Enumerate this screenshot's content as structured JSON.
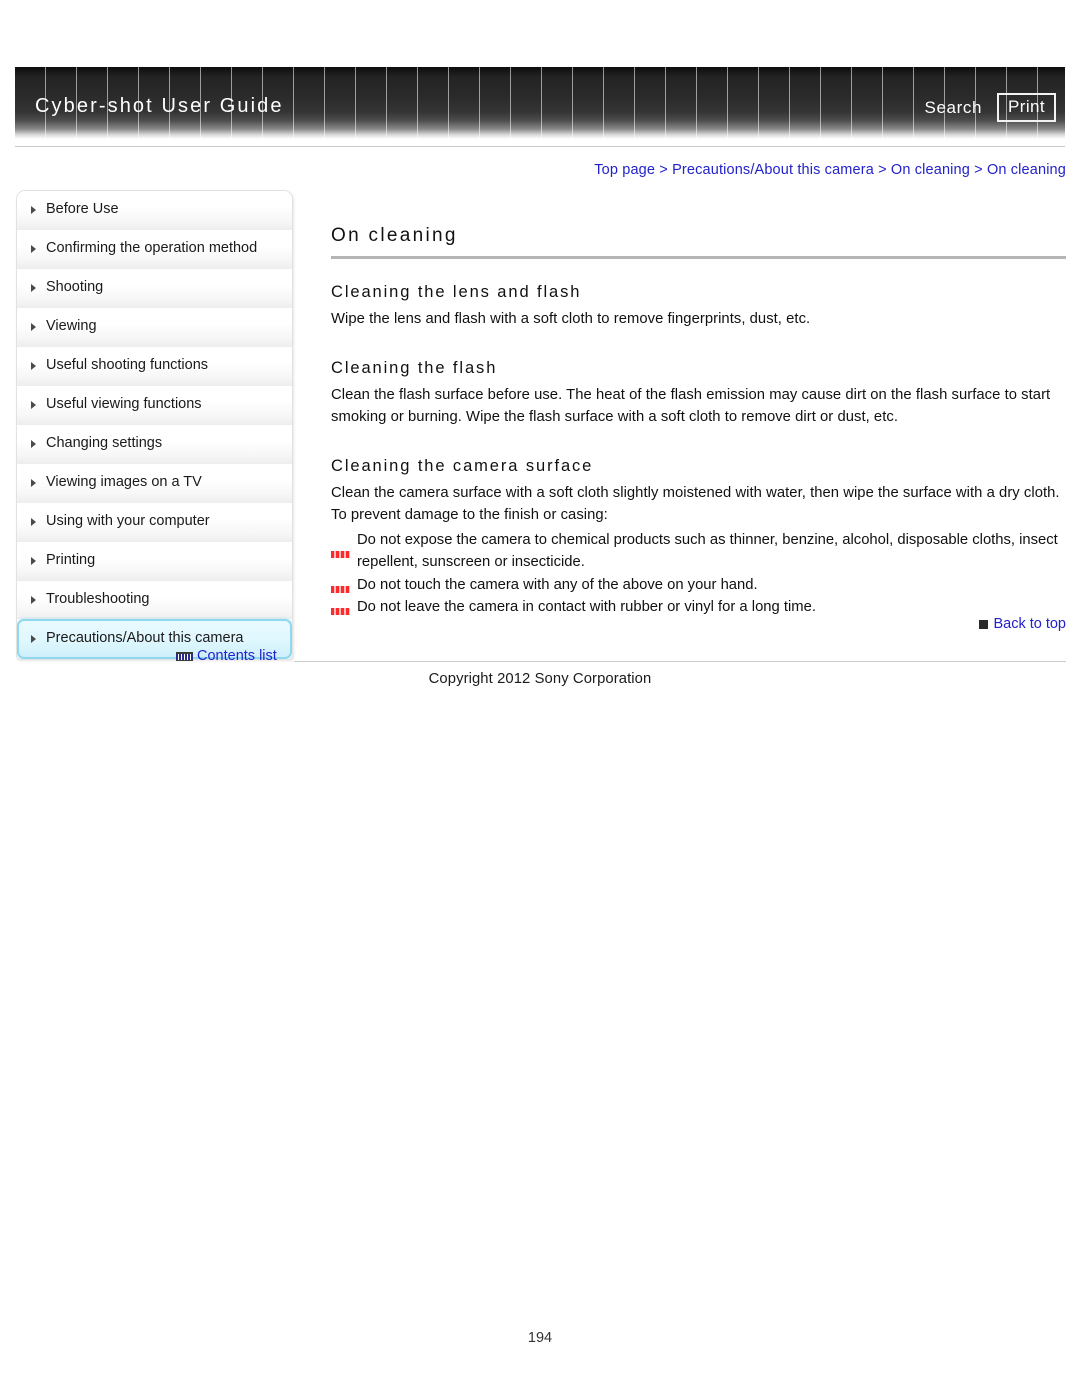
{
  "header": {
    "title": "Cyber-shot User Guide",
    "search_label": "Search",
    "print_label": "Print"
  },
  "breadcrumb": {
    "items": [
      "Top page",
      "Precautions/About this camera",
      "On cleaning",
      "On cleaning"
    ],
    "separator": ">"
  },
  "sidebar": {
    "items": [
      {
        "label": "Before Use",
        "active": false
      },
      {
        "label": "Confirming the operation method",
        "active": false
      },
      {
        "label": "Shooting",
        "active": false
      },
      {
        "label": "Viewing",
        "active": false
      },
      {
        "label": "Useful shooting functions",
        "active": false
      },
      {
        "label": "Useful viewing functions",
        "active": false
      },
      {
        "label": "Changing settings",
        "active": false
      },
      {
        "label": "Viewing images on a TV",
        "active": false
      },
      {
        "label": "Using with your computer",
        "active": false
      },
      {
        "label": "Printing",
        "active": false
      },
      {
        "label": "Troubleshooting",
        "active": false
      },
      {
        "label": "Precautions/About this camera",
        "active": true
      }
    ],
    "contents_list_label": "Contents list",
    "contents_list_icon": "list-icon"
  },
  "main": {
    "page_title": "On cleaning",
    "sections": [
      {
        "heading": "Cleaning the lens and flash",
        "paragraph": "Wipe the lens and flash with a soft cloth to remove fingerprints, dust, etc."
      },
      {
        "heading": "Cleaning the flash",
        "paragraph": "Clean the flash surface before use. The heat of the flash emission may cause dirt on the flash surface to start smoking or burning. Wipe the flash surface with a soft cloth to remove dirt or dust, etc."
      },
      {
        "heading": "Cleaning the camera surface",
        "paragraph": "Clean the camera surface with a soft cloth slightly moistened with water, then wipe the surface with a dry cloth. To prevent damage to the finish or casing:",
        "bullets": [
          "Do not expose the camera to chemical products such as thinner, benzine, alcohol, disposable cloths, insect repellent, sunscreen or insecticide.",
          "Do not touch the camera with any of the above on your hand.",
          "Do not leave the camera in contact with rubber or vinyl for a long time."
        ]
      }
    ],
    "back_to_top_label": "Back to top"
  },
  "footer": {
    "copyright": "Copyright 2012 Sony Corporation",
    "page_number": "194"
  },
  "colors": {
    "link": "#2222cc",
    "active_item_bg": "#dff7fe",
    "active_item_border": "#8fd8ee",
    "bullet_red": "#ff2020",
    "rule_gray": "#b5b5b5"
  }
}
